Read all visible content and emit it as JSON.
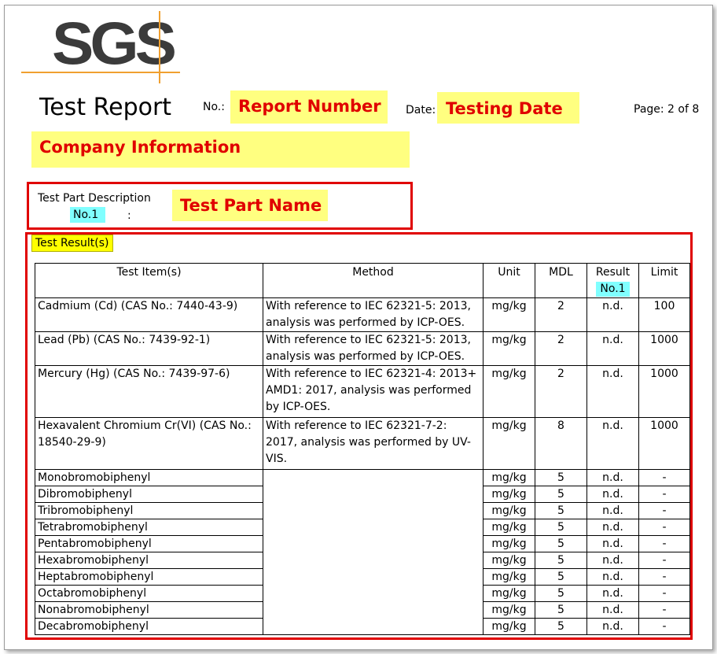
{
  "logo": {
    "text": "SGS",
    "accent_color": "#f0a030"
  },
  "header": {
    "title": "Test Report",
    "no_label": "No.:",
    "report_number": "Report Number",
    "date_label": "Date:",
    "testing_date": "Testing Date",
    "page": "Page: 2 of 8",
    "company": "Company Information"
  },
  "part": {
    "description_label": "Test Part Description",
    "tag": "No.1",
    "colon": ":",
    "name": "Test Part Name"
  },
  "results": {
    "section_label": "Test Result(s)",
    "columns": {
      "item": "Test Item(s)",
      "method": "Method",
      "unit": "Unit",
      "mdl": "MDL",
      "result": "Result",
      "result_tag": "No.1",
      "limit": "Limit"
    },
    "rows": [
      {
        "item": "Cadmium (Cd) (CAS No.: 7440-43-9)",
        "method": "With reference to IEC 62321-5: 2013, analysis was performed by ICP-OES.",
        "unit": "mg/kg",
        "mdl": "2",
        "result": "n.d.",
        "limit": "100"
      },
      {
        "item": "Lead (Pb) (CAS No.: 7439-92-1)",
        "method": "With reference to IEC 62321-5: 2013, analysis was performed by ICP-OES.",
        "unit": "mg/kg",
        "mdl": "2",
        "result": "n.d.",
        "limit": "1000"
      },
      {
        "item": "Mercury (Hg) (CAS No.: 7439-97-6)",
        "method": "With reference to IEC 62321-4: 2013+ AMD1: 2017, analysis was performed by ICP-OES.",
        "unit": "mg/kg",
        "mdl": "2",
        "result": "n.d.",
        "limit": "1000"
      },
      {
        "item": "Hexavalent Chromium Cr(VI) (CAS No.: 18540-29-9)",
        "method": "With reference to IEC 62321-7-2: 2017, analysis was performed by UV-VIS.",
        "unit": "mg/kg",
        "mdl": "8",
        "result": "n.d.",
        "limit": "1000"
      },
      {
        "item": "Monobromobiphenyl",
        "unit": "mg/kg",
        "mdl": "5",
        "result": "n.d.",
        "limit": "-"
      },
      {
        "item": "Dibromobiphenyl",
        "unit": "mg/kg",
        "mdl": "5",
        "result": "n.d.",
        "limit": "-"
      },
      {
        "item": "Tribromobiphenyl",
        "unit": "mg/kg",
        "mdl": "5",
        "result": "n.d.",
        "limit": "-"
      },
      {
        "item": "Tetrabromobiphenyl",
        "unit": "mg/kg",
        "mdl": "5",
        "result": "n.d.",
        "limit": "-"
      },
      {
        "item": "Pentabromobiphenyl",
        "unit": "mg/kg",
        "mdl": "5",
        "result": "n.d.",
        "limit": "-"
      },
      {
        "item": "Hexabromobiphenyl",
        "unit": "mg/kg",
        "mdl": "5",
        "result": "n.d.",
        "limit": "-"
      },
      {
        "item": "Heptabromobiphenyl",
        "unit": "mg/kg",
        "mdl": "5",
        "result": "n.d.",
        "limit": "-"
      },
      {
        "item": "Octabromobiphenyl",
        "unit": "mg/kg",
        "mdl": "5",
        "result": "n.d.",
        "limit": "-"
      },
      {
        "item": "Nonabromobiphenyl",
        "unit": "mg/kg",
        "mdl": "5",
        "result": "n.d.",
        "limit": "-"
      },
      {
        "item": "Decabromobiphenyl",
        "unit": "mg/kg",
        "mdl": "5",
        "result": "n.d.",
        "limit": "-"
      }
    ]
  },
  "colors": {
    "highlight_yellow": "#ffff80",
    "highlight_red_text": "#e00000",
    "tag_cyan": "#80ffff",
    "frame_red": "#e00000"
  }
}
